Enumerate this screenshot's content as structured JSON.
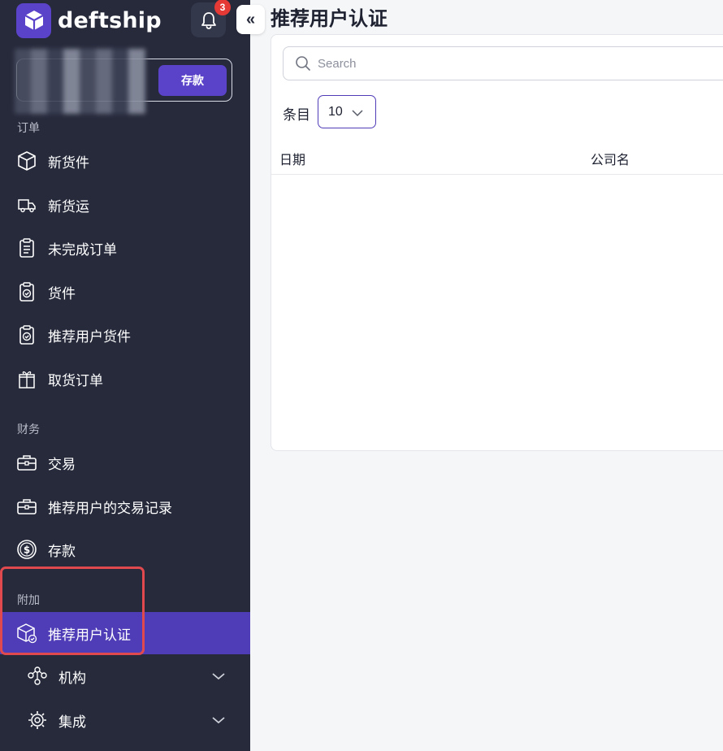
{
  "brand": {
    "name": "deftship"
  },
  "notifications": {
    "count": "3"
  },
  "collapse": {
    "label": "«"
  },
  "balance": {
    "deposit_label": "存款"
  },
  "sidebar": {
    "sections": [
      {
        "label": "订单",
        "items": [
          {
            "label": "新货件",
            "icon": "box-icon"
          },
          {
            "label": "新货运",
            "icon": "truck-icon"
          },
          {
            "label": "未完成订单",
            "icon": "clipboard-list-icon"
          },
          {
            "label": "货件",
            "icon": "clipboard-check-icon"
          },
          {
            "label": "推荐用户货件",
            "icon": "clipboard-check-icon"
          },
          {
            "label": "取货订单",
            "icon": "pickup-box-icon"
          }
        ]
      },
      {
        "label": "财务",
        "items": [
          {
            "label": "交易",
            "icon": "briefcase-icon"
          },
          {
            "label": "推荐用户的交易记录",
            "icon": "briefcase-icon"
          },
          {
            "label": "存款",
            "icon": "dollar-coin-icon"
          }
        ]
      },
      {
        "label": "附加",
        "items": [
          {
            "label": "推荐用户认证",
            "icon": "box-verified-icon",
            "active": true
          },
          {
            "label": "机构",
            "icon": "organization-icon",
            "expandable": true
          },
          {
            "label": "集成",
            "icon": "integration-gear-icon",
            "expandable": true
          }
        ]
      }
    ]
  },
  "main": {
    "title": "推荐用户认证",
    "search": {
      "placeholder": "Search"
    },
    "entries": {
      "label": "条目",
      "value": "10"
    },
    "table": {
      "columns": [
        "日期",
        "公司名"
      ]
    }
  },
  "colors": {
    "sidebar_bg": "#262a3b",
    "accent": "#4f3db8",
    "highlight": "#e04a4f"
  }
}
